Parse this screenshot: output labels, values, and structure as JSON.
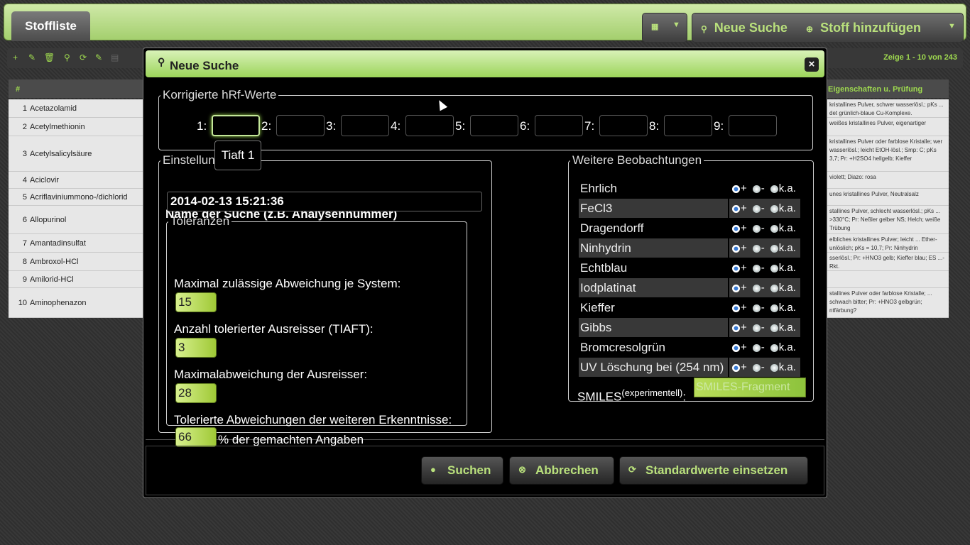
{
  "topbar": {
    "tab_label": "Stoffliste",
    "grid_icon": "grid-icon",
    "new_search": "Neue Suche",
    "add_substance": "Stoff hinzufügen"
  },
  "grid": {
    "pager": "Zeige 1 - 10 von 243",
    "col_num": "#",
    "col_props": "Eigenschaften u. Prüfung",
    "rows": [
      {
        "n": "1",
        "name": "Acetazolamid"
      },
      {
        "n": "2",
        "name": "Acetylmethionin"
      },
      {
        "n": "3",
        "name": "Acetylsalicylsäure"
      },
      {
        "n": "4",
        "name": "Aciclovir"
      },
      {
        "n": "5",
        "name": "Acriflaviniummono-/dichlorid"
      },
      {
        "n": "6",
        "name": "Allopurinol"
      },
      {
        "n": "7",
        "name": "Amantadinsulfat"
      },
      {
        "n": "8",
        "name": "Ambroxol-HCl"
      },
      {
        "n": "9",
        "name": "Amilorid-HCl"
      },
      {
        "n": "10",
        "name": "Aminophenazon"
      }
    ],
    "props": [
      "kristallines Pulver, schwer wasserlösl.; pKs ... det grünlich-blaue Cu-Komplexe.",
      "weißes kristallines Pulver, eigenartiger",
      "kristallines Pulver oder farblose Kristalle; wer wasserlösl.; leicht EtOH-lösl.; Smp: C; pKs 3,7; Pr: +H2SO4 hellgelb; Kieffer",
      "violett; Diazo: rosa",
      "unes kristallines Pulver, Neutralsalz",
      "stallines Pulver, schlecht wasserlösl.; pKs ... >330°C; Pr: Neßler gelber NS; Helch; weiße Trübung",
      "elbliches kristallines Pulver; leicht ... Ether-unlöslich; pKs = 10,7; Pr: Ninhydrin",
      "sserlösl.; Pr: +HNO3 gelb; Kieffer blau; ES ...-Rkt.",
      "",
      "stallines Pulver oder farblose Kristalle; ... schwach bitter; Pr: +HNO3 gelbgrün; ntfärbung?"
    ]
  },
  "dialog": {
    "title": "Neue Suche",
    "close": "×",
    "hrf_legend": "Korrigierte hRf-Werte",
    "hrf_labels": [
      "1:",
      "2:",
      "3:",
      "4:",
      "5:",
      "6:",
      "7:",
      "8:",
      "9:"
    ],
    "tooltip": "Tiaft 1",
    "settings_legend": "Einstellungen",
    "name_label": "Name der Suche (z.B. Analysennummer)",
    "name_value": "2014-02-13 15:21:36",
    "tol_legend": "Toleranzen",
    "tol": {
      "max_dev_label": "Maximal zulässige Abweichung je System:",
      "max_dev_value": "15",
      "outliers_label": "Anzahl tolerierter Ausreisser (TIAFT):",
      "outliers_value": "3",
      "outlier_dev_label": "Maximalabweichung der Ausreisser:",
      "outlier_dev_value": "28",
      "tolerated_label": "Tolerierte Abweichungen der weiteren Erkenntnisse:",
      "tolerated_value": "66",
      "tolerated_suffix": "% der gemachten Angaben"
    },
    "obs_legend": "Weitere Beobachtungen",
    "observations": [
      {
        "name": "Ehrlich"
      },
      {
        "name": "FeCl3"
      },
      {
        "name": "Dragendorff"
      },
      {
        "name": "Ninhydrin"
      },
      {
        "name": "Echtblau"
      },
      {
        "name": "Iodplatinat"
      },
      {
        "name": "Kieffer"
      },
      {
        "name": "Gibbs"
      },
      {
        "name": "Bromcresolgrün"
      },
      {
        "name": "UV Löschung bei (254 nm)"
      }
    ],
    "radio_plus": "+",
    "radio_minus": "-",
    "radio_ka": "k.a.",
    "smiles_label": "SMILES",
    "smiles_sup": "(experimentell)",
    "smiles_colon": ":",
    "smiles_placeholder": "SMILES-Fragment",
    "buttons": {
      "search": "Suchen",
      "cancel": "Abbrechen",
      "defaults": "Standardwerte einsetzen"
    }
  }
}
